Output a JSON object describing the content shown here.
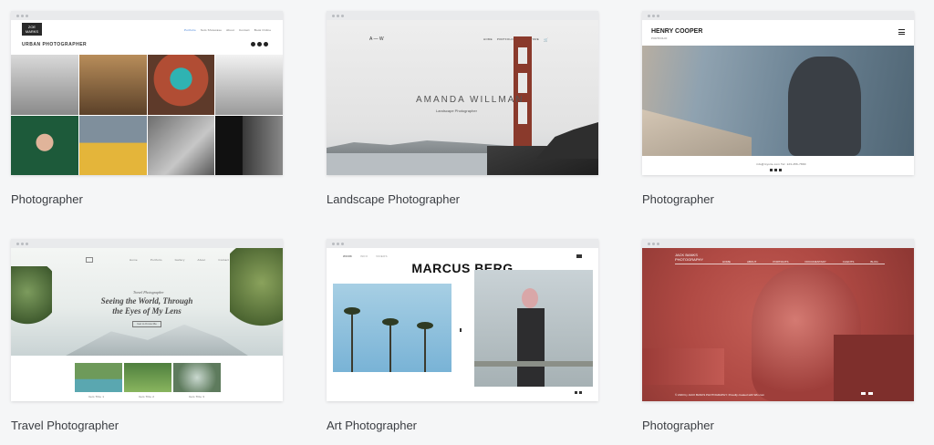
{
  "cards": [
    {
      "title": "Photographer",
      "preview": {
        "logo_line1": "ZOE",
        "logo_line2": "MARKS",
        "subtitle": "URBAN PHOTOGRAPHER",
        "nav": [
          "Portfolio",
          "Solo Showcase",
          "About",
          "Contact",
          "Book Online"
        ]
      }
    },
    {
      "title": "Landscape Photographer",
      "preview": {
        "logo": "A — W",
        "nav": [
          "HOME",
          "PORTFOLIO",
          "BIO",
          "STORE"
        ],
        "name": "AMANDA WILLMAN",
        "subtitle": "Landscape Photographer"
      }
    },
    {
      "title": "Photographer",
      "preview": {
        "name": "HENRY COOPER",
        "subtitle": "PORTFOLIO",
        "footer_line1": "info@mysite.com",
        "footer_line2": "Tel: 123-456-7890"
      }
    },
    {
      "title": "Travel Photographer",
      "preview": {
        "tag": "Travel Photographer",
        "headline1": "Seeing the World, Through",
        "headline2": "the Eyes of My Lens",
        "button": "Get to Know Me",
        "nav": [
          "Home",
          "Portfolio",
          "Gallery",
          "About",
          "Contact"
        ],
        "thumbs": [
          "Item Title 1",
          "Item Title 2",
          "Item Title 3"
        ]
      }
    },
    {
      "title": "Art Photographer",
      "preview": {
        "nav": [
          "WORK",
          "INFO",
          "VIDEOS"
        ],
        "name": "MARCUS BERG"
      }
    },
    {
      "title": "Photographer",
      "preview": {
        "logo_line1": "JACK BANKS",
        "logo_line2": "PHOTOGRAPHY",
        "nav": [
          "HOME",
          "ABOUT",
          "PORTRAITS",
          "DOCUMENTARY",
          "CLIENTS",
          "BLOG"
        ],
        "footer": "© 2023 by JACK BANKS PHOTOGRAPHY. Proudly created with Wix.com"
      }
    }
  ],
  "colors": {
    "background": "#f5f6f7",
    "title_text": "#3a3d42",
    "jack_red": "#b84a45",
    "sky_blue": "#8fc0dc"
  }
}
